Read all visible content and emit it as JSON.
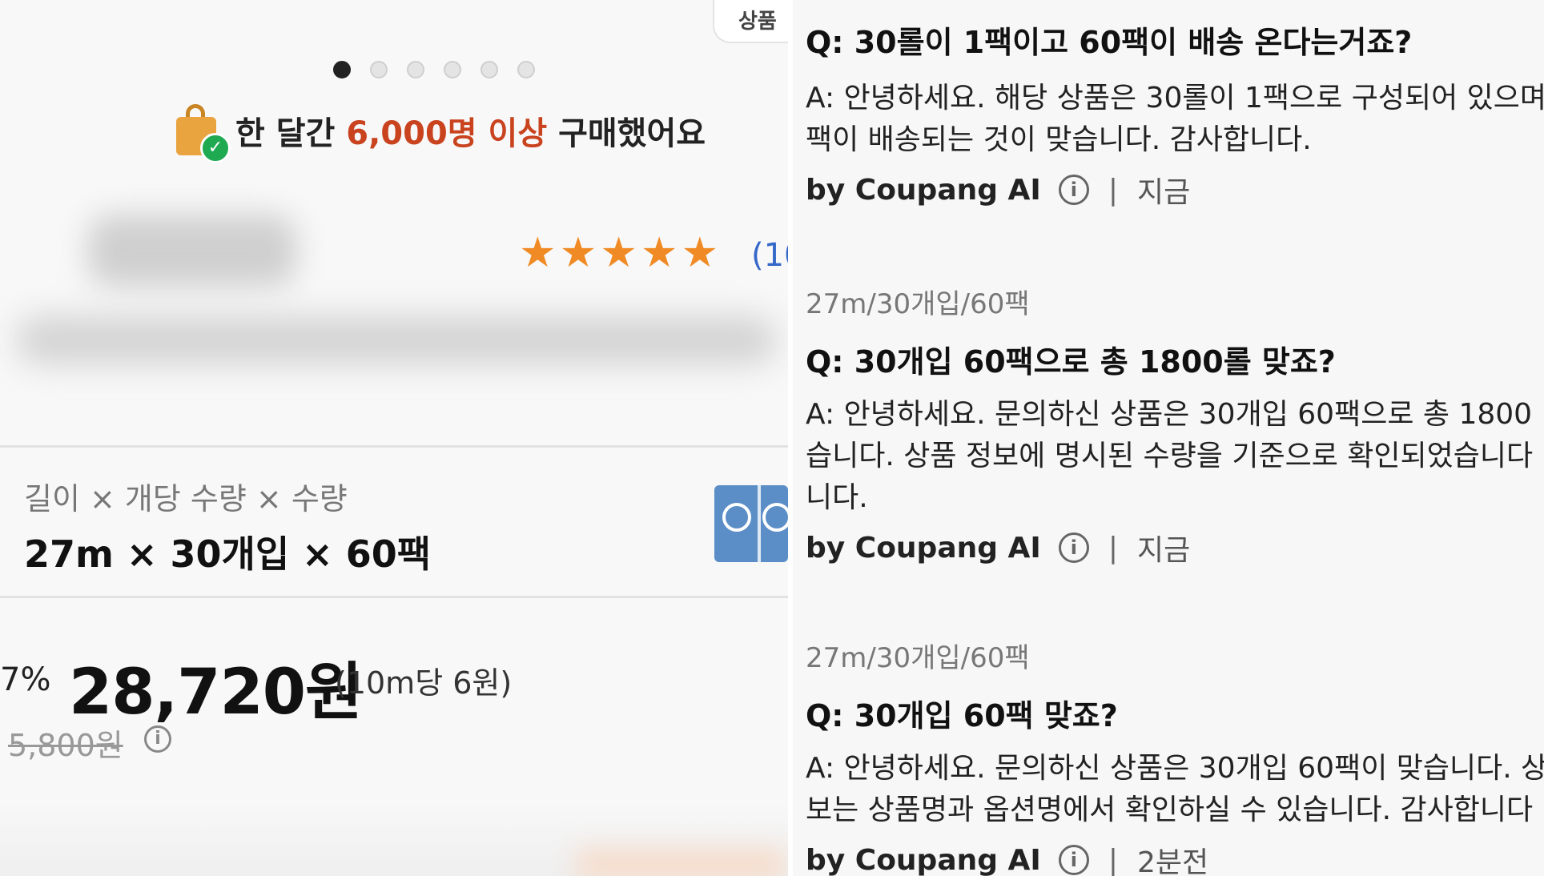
{
  "left": {
    "top_tab_label": "상품",
    "image_dots": {
      "count": 6,
      "active_index": 0
    },
    "purchase_badge": {
      "prefix": "한 달간",
      "highlight": "6,000명 이상",
      "suffix": "구매했어요"
    },
    "rating": {
      "stars": 5,
      "count_partial": "(10"
    },
    "option": {
      "label": "길이 × 개당 수량 × 수량",
      "value": "27m × 30개입 × 60팩"
    },
    "price": {
      "discount": "7%",
      "sale_price": "28,720원",
      "unit_price": "(10m당 6원)",
      "original_price": "5,800원"
    }
  },
  "right": {
    "qa": [
      {
        "option": "",
        "question": "Q: 30롤이 1팩이고 60팩이 배송 온다는거죠?",
        "answer_lines": [
          "A: 안녕하세요. 해당 상품은 30롤이 1팩으로 구성되어 있으며",
          "팩이 배송되는 것이 맞습니다. 감사합니다."
        ],
        "by": "by Coupang AI",
        "time": "지금"
      },
      {
        "option": "27m/30개입/60팩",
        "question": "Q: 30개입 60팩으로 총 1800롤 맞죠?",
        "answer_lines": [
          "A: 안녕하세요. 문의하신 상품은 30개입 60팩으로 총 1800",
          "습니다. 상품 정보에 명시된 수량을 기준으로 확인되었습니다",
          "니다."
        ],
        "by": "by Coupang AI",
        "time": "지금"
      },
      {
        "option": "27m/30개입/60팩",
        "question": "Q: 30개입 60팩 맞죠?",
        "answer_lines": [
          "A: 안녕하세요. 문의하신 상품은 30개입 60팩이 맞습니다. 상",
          "보는 상품명과 옵션명에서 확인하실 수 있습니다. 감사합니다"
        ],
        "by": "by Coupang AI",
        "time": "2분전"
      }
    ]
  },
  "colors": {
    "highlight": "#c9431f",
    "star": "#f08a24",
    "rating_count": "#3568c9"
  },
  "icons": [
    "shopping-bag-check-icon",
    "star-icon",
    "info-icon",
    "product-thumbnail"
  ]
}
